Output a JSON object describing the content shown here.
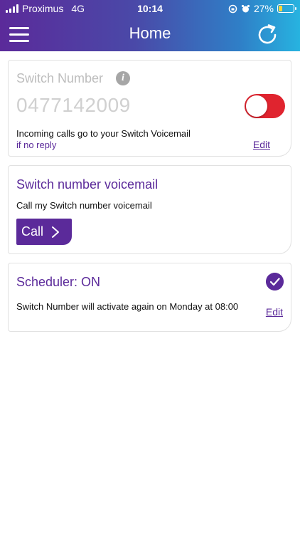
{
  "status_bar": {
    "carrier": "Proximus",
    "network": "4G",
    "time": "10:14",
    "battery_percent": "27%",
    "battery_level": 0.27
  },
  "header": {
    "title": "Home",
    "menu_icon": "hamburger-menu-icon",
    "refresh_icon": "refresh-icon"
  },
  "switch_card": {
    "label": "Switch Number",
    "info_icon_glyph": "i",
    "number": "0477142009",
    "toggle_state": "off",
    "incoming_text": "Incoming calls go to your Switch Voicemail",
    "condition_text": "if no reply",
    "edit_label": "Edit"
  },
  "voicemail_card": {
    "title": "Switch number voicemail",
    "subtitle": "Call my Switch number voicemail",
    "call_label": "Call"
  },
  "scheduler_card": {
    "title": "Scheduler: ON",
    "status_text": "Switch Number will activate again on Monday at 08:00",
    "edit_label": "Edit"
  },
  "colors": {
    "brand_purple": "#5b2a9a",
    "toggle_red": "#e0242f",
    "header_gradient_start": "#5b2a9a",
    "header_gradient_end": "#27b3e0"
  }
}
